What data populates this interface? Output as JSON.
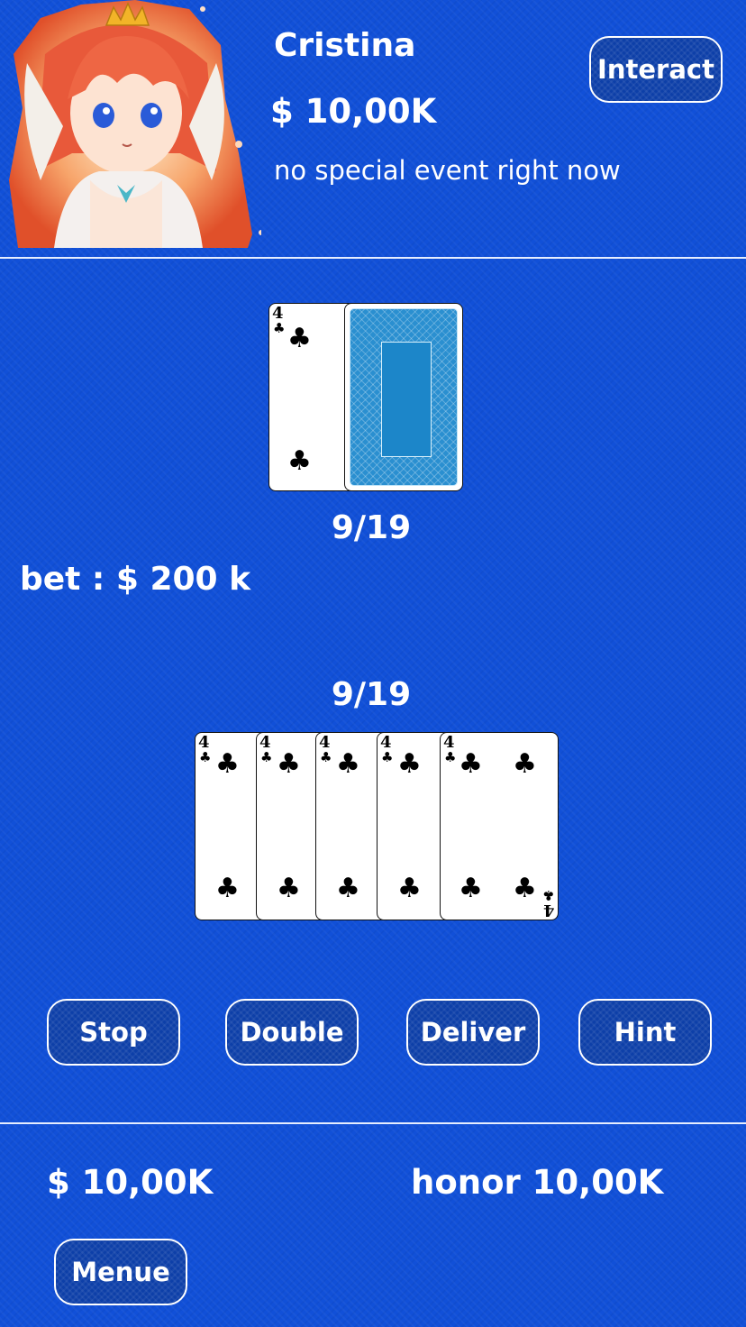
{
  "opponent": {
    "name": "Cristina",
    "money": "$ 10,00K",
    "status": "no special event right now",
    "interact_label": "Interact"
  },
  "dealer": {
    "score": "9/19",
    "cards": [
      {
        "rank": "4",
        "suit": "♣",
        "face_up": true
      },
      {
        "face_up": false
      }
    ]
  },
  "bet": "bet : $ 200 k",
  "player": {
    "score": "9/19",
    "cards": [
      {
        "rank": "4",
        "suit": "♣"
      },
      {
        "rank": "4",
        "suit": "♣"
      },
      {
        "rank": "4",
        "suit": "♣"
      },
      {
        "rank": "4",
        "suit": "♣"
      },
      {
        "rank": "4",
        "suit": "♣"
      }
    ],
    "money": "$ 10,00K",
    "honor": "honor 10,00K"
  },
  "actions": {
    "stop": "Stop",
    "double": "Double",
    "deliver": "Deliver",
    "hint": "Hint"
  },
  "menu_label": "Menue",
  "colors": {
    "background": "#1150d8",
    "button_fill": "#0d3fa8",
    "card_back": "#2a8fd0"
  }
}
